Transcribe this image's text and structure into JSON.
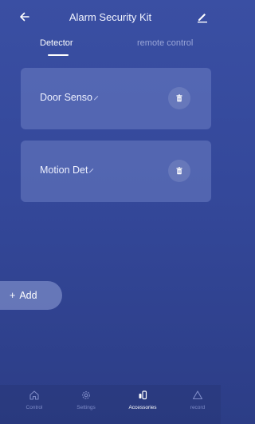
{
  "header": {
    "title": "Alarm Security Kit"
  },
  "tabs": [
    {
      "label": "Detector",
      "active": true
    },
    {
      "label": "remote control",
      "active": false
    }
  ],
  "devices": [
    {
      "label": "Door Senso"
    },
    {
      "label": "Motion Det"
    }
  ],
  "add_button": {
    "label": "Add"
  },
  "bottom_nav": [
    {
      "label": "Control",
      "icon": "home-icon",
      "active": false
    },
    {
      "label": "Settings",
      "icon": "gear-icon",
      "active": false
    },
    {
      "label": "Accessories",
      "icon": "accessories-icon",
      "active": true
    },
    {
      "label": "record",
      "icon": "warning-icon",
      "active": false
    }
  ],
  "colors": {
    "background_top": "#3a4fa3",
    "background_bottom": "#2c3d86",
    "card": "#6b7dc2",
    "inactive_text": "#9aa6d8"
  }
}
